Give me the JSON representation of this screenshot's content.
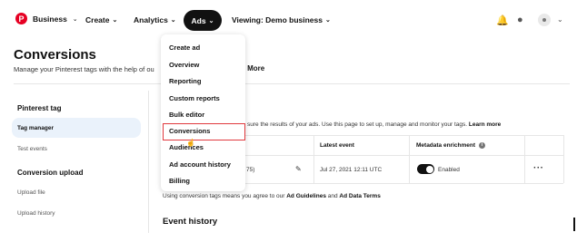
{
  "header": {
    "brand_label": "Business",
    "nav": {
      "create": "Create",
      "analytics": "Analytics",
      "ads": "Ads",
      "viewing": "Viewing: Demo business"
    },
    "icons": [
      "pinterest-logo",
      "bell-icon",
      "chat-icon",
      "avatar",
      "chevron-down-icon"
    ]
  },
  "page": {
    "title": "Conversions",
    "subtitle": "Manage your Pinterest tags with the help of ou",
    "subtitle_tail": "n More"
  },
  "sidebar": {
    "section1": "Pinterest tag",
    "tag_manager": "Tag manager",
    "test_events": "Test events",
    "section2": "Conversion upload",
    "upload_file": "Upload file",
    "upload_history": "Upload history"
  },
  "content": {
    "description_start": "sure the results of your ads. Use this page to set up, manage and monitor your tags.",
    "description_link": "Learn more",
    "table": {
      "headers": {
        "latest_event": "Latest event",
        "metadata": "Metadata enrichment"
      },
      "row": {
        "tag_id_partial": "75)",
        "latest_event": "Jul 27, 2021 12:11 UTC",
        "metadata_state": "Enabled",
        "metadata_enabled": true
      }
    },
    "agreement": {
      "prefix": "Using conversion tags means you agree to our",
      "link1": "Ad Guidelines",
      "mid": "and",
      "link2": "Ad Data Terms"
    },
    "event_history": "Event history"
  },
  "ads_menu": {
    "items": [
      "Create ad",
      "Overview",
      "Reporting",
      "Custom reports",
      "Bulk editor",
      "Conversions",
      "Audiences",
      "Ad account history",
      "Billing"
    ],
    "highlighted": "Conversions"
  },
  "colors": {
    "accent_red": "#e60023",
    "highlight_border": "#e0393e",
    "active_nav": "#111111",
    "sidebar_active_bg": "#eaf2fb"
  }
}
